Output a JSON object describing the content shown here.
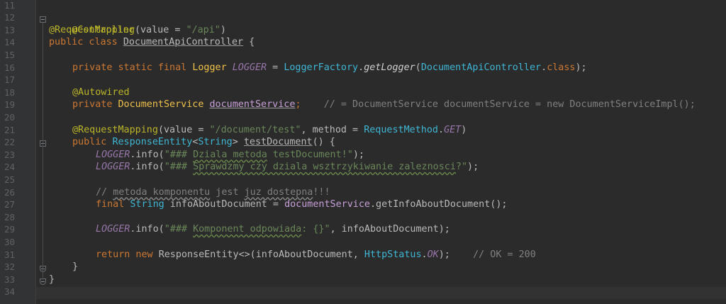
{
  "gutter": {
    "line_numbers": [
      "11",
      "12",
      "13",
      "14",
      "15",
      "16",
      "17",
      "18",
      "19",
      "20",
      "21",
      "22",
      "23",
      "24",
      "25",
      "26",
      "27",
      "28",
      "29",
      "30",
      "31",
      "32",
      "33",
      "34"
    ]
  },
  "code": {
    "l12": {
      "ann": "@Controller"
    },
    "l13": {
      "ann": "@RequestMapping",
      "p1": "(",
      "attr": "value",
      "eq": " = ",
      "str": "\"/api\"",
      "p2": ")"
    },
    "l14": {
      "kw": "public class ",
      "name": "DocumentApiController",
      "rest": " {"
    },
    "l16": {
      "kw": "private static final ",
      "type": "Logger",
      "sp": " ",
      "fld": "LOGGER",
      "eq": " = ",
      "cls": "LoggerFactory",
      "dot": ".",
      "fn": "getLogger",
      "p1": "(",
      "arg": "DocumentApiController",
      "dot2": ".",
      "kw2": "class",
      "p2": ");"
    },
    "l18": {
      "ann": "@Autowired"
    },
    "l19": {
      "kw": "private ",
      "type": "DocumentService",
      "sp": " ",
      "fld": "documentService",
      "semi": ";",
      "cmt": "    // = DocumentService documentService = new DocumentServiceImpl();"
    },
    "l21": {
      "ann": "@RequestMapping",
      "p1": "(",
      "attr": "value",
      "eq": " = ",
      "str": "\"/document/test\"",
      "comma": ", ",
      "attr2": "method",
      "eq2": " = ",
      "cls": "RequestMethod",
      "dot": ".",
      "fld": "GET",
      "p2": ")"
    },
    "l22": {
      "kw": "public ",
      "type": "ResponseEntity",
      "lt": "<",
      "type2": "String",
      "gt": "> ",
      "fn": "testDocument",
      "rest": "() {"
    },
    "l23": {
      "fld": "LOGGER",
      "call": ".info(",
      "str_a": "\"### ",
      "str_b": "Dziala metoda",
      "str_c": " testDocument!\"",
      "end": ");"
    },
    "l24": {
      "fld": "LOGGER",
      "call": ".info(",
      "str_a": "\"### ",
      "str_b": "Sprawdzmy czy dziala wsztrzykiwanie zaleznosci",
      "str_c": "?\"",
      "end": ");"
    },
    "l26": {
      "cmt_a": "// ",
      "cmt_b": "metoda komponentu",
      "cmt_c": " jest ",
      "cmt_d": "juz dostepna",
      "cmt_e": "!!!"
    },
    "l27": {
      "kw": "final ",
      "type": "String",
      "rest": " infoAboutDocument = ",
      "fld": "documentService",
      "call": ".getInfoAboutDocument();"
    },
    "l29": {
      "fld": "LOGGER",
      "call": ".info(",
      "str_a": "\"### ",
      "str_b": "Komponent odpowiada",
      "str_c": ": {}\"",
      "end": ", infoAboutDocument);"
    },
    "l31": {
      "kw": "return new ",
      "rest": "ResponseEntity<>(infoAboutDocument, ",
      "cls": "HttpStatus",
      "dot": ".",
      "fld": "OK",
      "end": ");",
      "cmt": "    // OK = 200"
    },
    "l32": {
      "text": "}"
    },
    "l33": {
      "text": "}"
    }
  }
}
